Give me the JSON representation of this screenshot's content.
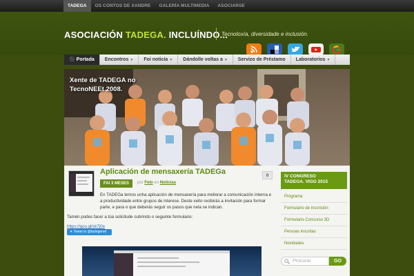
{
  "topnav": {
    "items": [
      "TADEGA",
      "OS CONTOS DE XANDRE",
      "GALERÍA MULTIMEDIA",
      "ASOCIARSE"
    ]
  },
  "header": {
    "title_part1": "ASOCIACIÓN ",
    "title_part2": "TADEGA.",
    "title_part3": " INCLUÍNDO...",
    "tagline": "Tecnoloxía, diversidade e inclusión."
  },
  "social_icons": [
    "rss-icon",
    "delicious-icon",
    "twitter-icon",
    "youtube-icon",
    "google-icon"
  ],
  "mainnav": {
    "items": [
      {
        "label": "Portada",
        "has_arrow": false
      },
      {
        "label": "Encontros",
        "has_arrow": true
      },
      {
        "label": "Foi noticia",
        "has_arrow": true
      },
      {
        "label": "Dándolle voltas a",
        "has_arrow": true
      },
      {
        "label": "Servizo de Préstamo",
        "has_arrow": false
      },
      {
        "label": "Laboratorios",
        "has_arrow": true
      }
    ]
  },
  "hero": {
    "caption_line1": "Xente de TADEGA no",
    "caption_line2": "TecnoNEEt 2008."
  },
  "post": {
    "title": "Aplicación de mensaxería TADEGa",
    "comments": "0",
    "date": "FAI 3 MESES",
    "by": "por",
    "author": "Felo",
    "in": "en",
    "category": "Noticias",
    "p1": "En TADEGa temos unha aplicación de mensaxería para mellorar a comunicación interna e a productividade entre grupos de interese. Deste xeito recibirás a invitación para formar parte, e para o que deberás seguir os pasos que nela se indican.",
    "p2": "Tamén podes facer a túa solicitude cubrindo o seguinte formulario:",
    "link": "https://goo.gl/sk7j0e",
    "tweet": "Tweet to @tadegenet"
  },
  "sidebar": {
    "widget_title_line1": "IV CONGRESO",
    "widget_title_line2": "TADEGA. VIGO 2015",
    "links": [
      "Programa",
      "Formulario de inscrición",
      "Formulario Concurso 3D",
      "Persoas inscritas",
      "Novidades"
    ],
    "search_placeholder": "Procurar",
    "search_button": "GO"
  },
  "colors": {
    "background": "#3d4d0e",
    "accent": "#c4e03c",
    "link_green": "#5b8a0e",
    "widget_green": "#6a9a14"
  }
}
